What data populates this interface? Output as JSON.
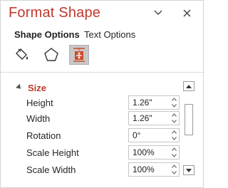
{
  "pane": {
    "title": "Format Shape",
    "dropdown_icon": "chevron-down-icon",
    "close_icon": "close-icon"
  },
  "tabs": [
    {
      "label": "Shape Options",
      "active": true
    },
    {
      "label": "Text Options",
      "active": false
    }
  ],
  "icon_tabs": [
    {
      "name": "fill-line-icon",
      "selected": false
    },
    {
      "name": "effects-icon",
      "selected": false
    },
    {
      "name": "size-properties-icon",
      "selected": true
    }
  ],
  "section": {
    "label": "Size",
    "expanded": true
  },
  "fields": [
    {
      "label": "Height",
      "value": "1.26\""
    },
    {
      "label": "Width",
      "value": "1.26\""
    },
    {
      "label": "Rotation",
      "value": "0°"
    },
    {
      "label": "Scale Height",
      "value": "100%"
    },
    {
      "label": "Scale Width",
      "value": "100%"
    }
  ],
  "colors": {
    "accent": "#c0392b",
    "selected_icon_bg": "#c8c8c8",
    "icon_active": "#d04a2b"
  }
}
